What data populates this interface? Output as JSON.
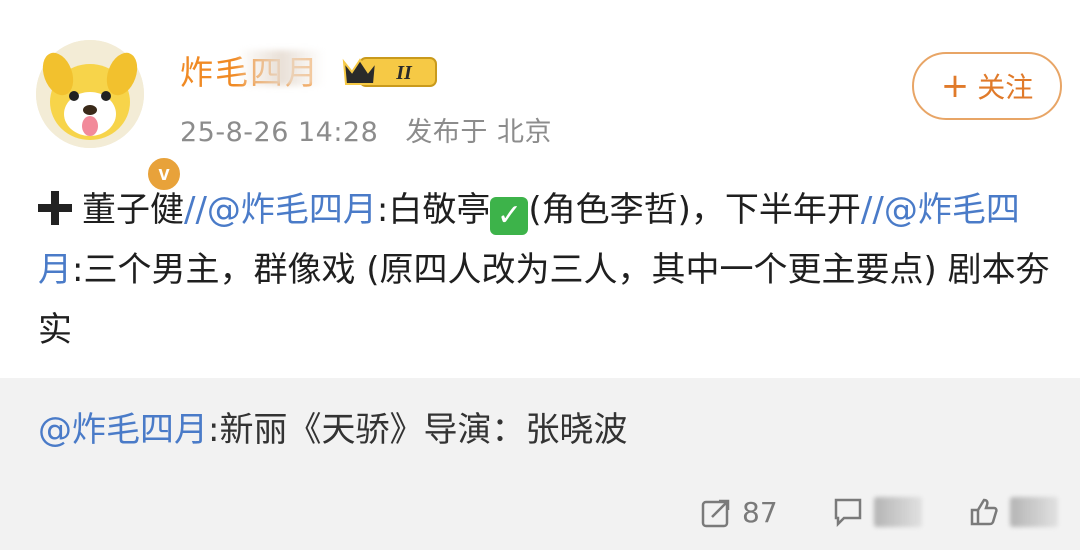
{
  "post": {
    "author": {
      "name": "炸毛四月",
      "verified_badge": "v",
      "vip_level": "II",
      "avatar_icon": "dog-avatar"
    },
    "timestamp": "25-8-26 14:28",
    "source": "发布于 北京",
    "follow_label": "关注",
    "body": {
      "prefix": "董子健",
      "mention1": "//@炸毛四月",
      "text1": ":白敬亭",
      "text2": "(角色李哲)，下半年开",
      "mention2": "//@炸毛四月",
      "text3": ":三个男主，群像戏 (原四人改为三人，其中一个更主要点) 剧本夯实"
    },
    "repost": {
      "mention": "@炸毛四月",
      "text": ":新丽《天骄》导演：张晓波"
    },
    "actions": {
      "share_count": "87",
      "comment_count": "",
      "like_count": ""
    }
  },
  "colors": {
    "username": "#f08a24",
    "mention": "#4a7bc8",
    "follow_border": "#e8a566",
    "repost_bg": "#f2f2f2"
  }
}
